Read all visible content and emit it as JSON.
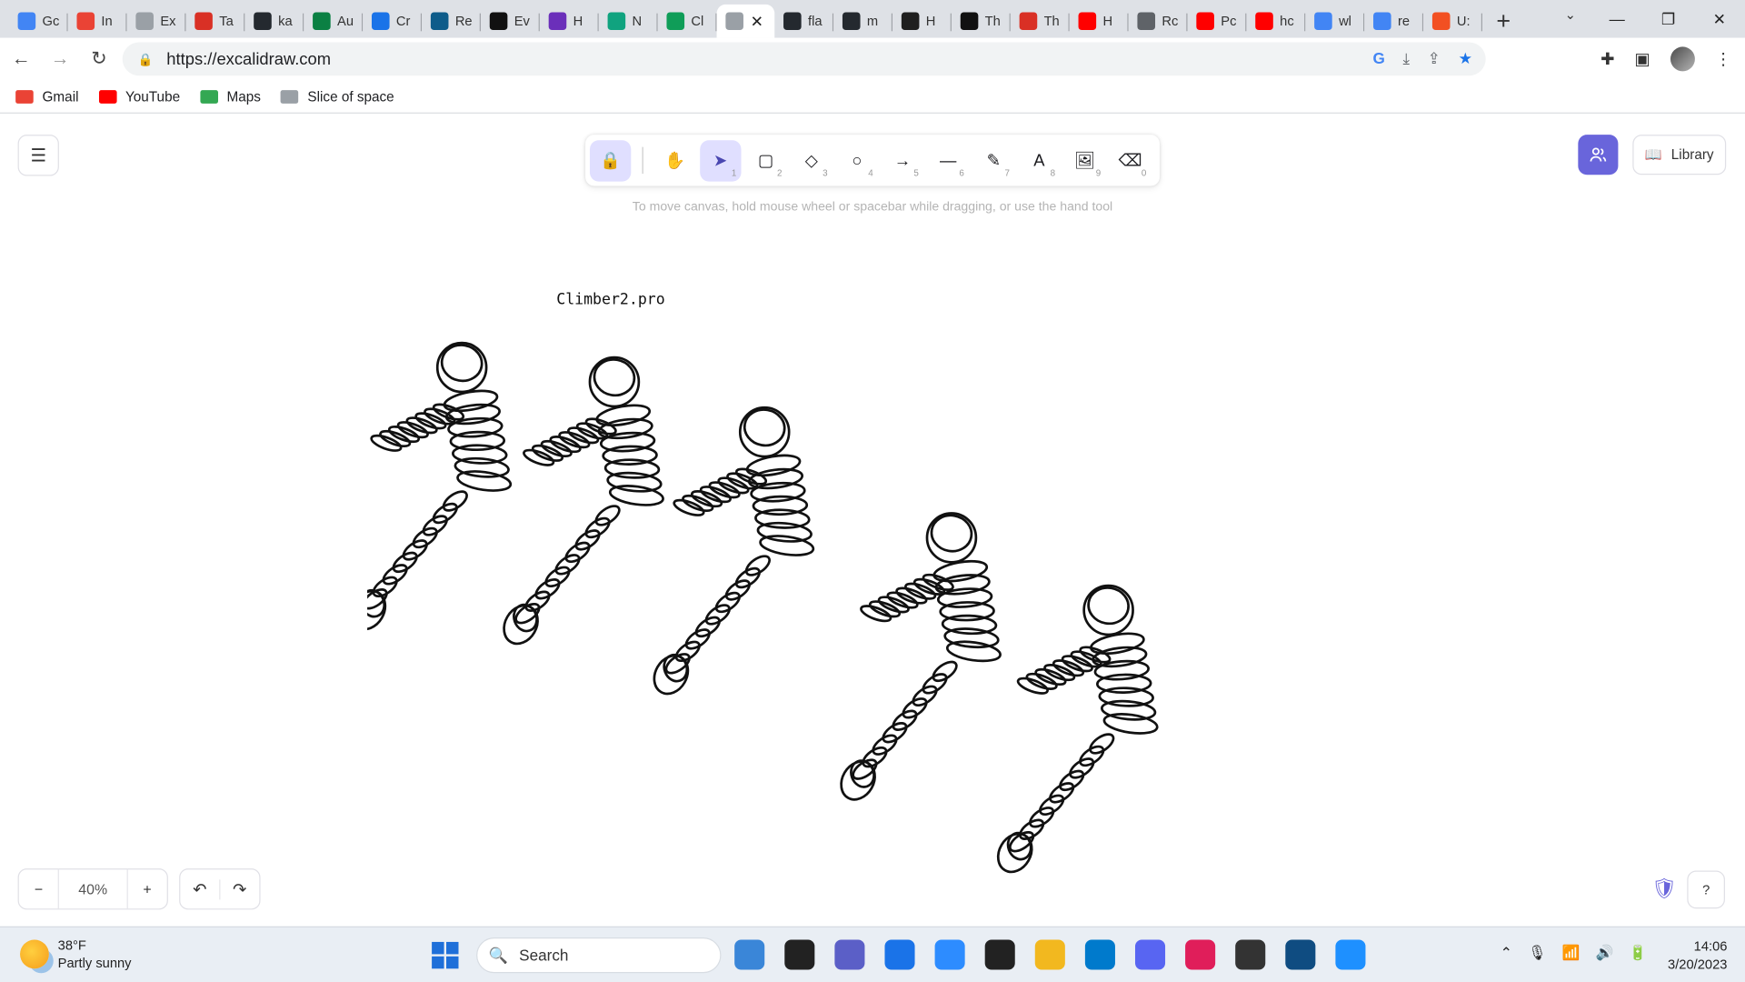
{
  "browser": {
    "tabs": [
      {
        "title": "Gc",
        "color": "#4285f4"
      },
      {
        "title": "In",
        "color": "#ea4335"
      },
      {
        "title": "Ex",
        "color": "#9aa0a6"
      },
      {
        "title": "Ta",
        "color": "#d93025"
      },
      {
        "title": "ka",
        "color": "#24292f"
      },
      {
        "title": "Au",
        "color": "#0b8043"
      },
      {
        "title": "Cr",
        "color": "#1a73e8"
      },
      {
        "title": "Re",
        "color": "#0e5c8a"
      },
      {
        "title": "Ev",
        "color": "#111111"
      },
      {
        "title": "H",
        "color": "#6b2fba"
      },
      {
        "title": "N",
        "color": "#10a37f"
      },
      {
        "title": "Cl",
        "color": "#0f9d58"
      },
      {
        "title": "",
        "color": "#9aa0a6",
        "active": true
      },
      {
        "title": "fla",
        "color": "#24292f"
      },
      {
        "title": "m",
        "color": "#24292f"
      },
      {
        "title": "H",
        "color": "#1f1f1f"
      },
      {
        "title": "Th",
        "color": "#111111"
      },
      {
        "title": "Th",
        "color": "#d93025"
      },
      {
        "title": "H",
        "color": "#ff0000"
      },
      {
        "title": "Rc",
        "color": "#5f6368"
      },
      {
        "title": "Pc",
        "color": "#ff0000"
      },
      {
        "title": "hc",
        "color": "#ff0000"
      },
      {
        "title": "wl",
        "color": "#4285f4"
      },
      {
        "title": "re",
        "color": "#4285f4"
      },
      {
        "title": "U:",
        "color": "#f25022"
      }
    ],
    "url": "https://excalidraw.com",
    "bookmarks": [
      {
        "label": "Gmail",
        "color": "#ea4335"
      },
      {
        "label": "YouTube",
        "color": "#ff0000"
      },
      {
        "label": "Maps",
        "color": "#34a853"
      },
      {
        "label": "Slice of space",
        "color": "#9aa0a6"
      }
    ]
  },
  "excalidraw": {
    "tools": [
      {
        "name": "lock",
        "glyph": "🔒",
        "num": "",
        "selected": true
      },
      {
        "name": "hand",
        "glyph": "✋",
        "num": "",
        "selected": false
      },
      {
        "name": "selection",
        "glyph": "➤",
        "num": "1",
        "selected": true
      },
      {
        "name": "rectangle",
        "glyph": "▢",
        "num": "2",
        "selected": false
      },
      {
        "name": "diamond",
        "glyph": "◇",
        "num": "3",
        "selected": false
      },
      {
        "name": "ellipse",
        "glyph": "○",
        "num": "4",
        "selected": false
      },
      {
        "name": "arrow",
        "glyph": "→",
        "num": "5",
        "selected": false
      },
      {
        "name": "line",
        "glyph": "—",
        "num": "6",
        "selected": false
      },
      {
        "name": "draw",
        "glyph": "✎",
        "num": "7",
        "selected": false
      },
      {
        "name": "text",
        "glyph": "A",
        "num": "8",
        "selected": false
      },
      {
        "name": "image",
        "glyph": "🖼",
        "num": "9",
        "selected": false
      },
      {
        "name": "eraser",
        "glyph": "⌫",
        "num": "0",
        "selected": false
      }
    ],
    "hint": "To move canvas, hold mouse wheel or spacebar while dragging, or use the hand tool",
    "library_label": "Library",
    "zoom_level": "40%",
    "canvas_text": "Climber2.pro"
  },
  "taskbar": {
    "temperature": "38°F",
    "weather": "Partly sunny",
    "search_label": "Search",
    "time": "14:06",
    "date": "3/20/2023",
    "apps": [
      "#3a86d8",
      "#222222",
      "#5b5fc7",
      "#1a73e8",
      "#2d8cff",
      "#222222",
      "#f2b81f",
      "#007acc",
      "#5865f2",
      "#e01e5a",
      "#333333",
      "#0f4c81",
      "#1e90ff"
    ]
  }
}
